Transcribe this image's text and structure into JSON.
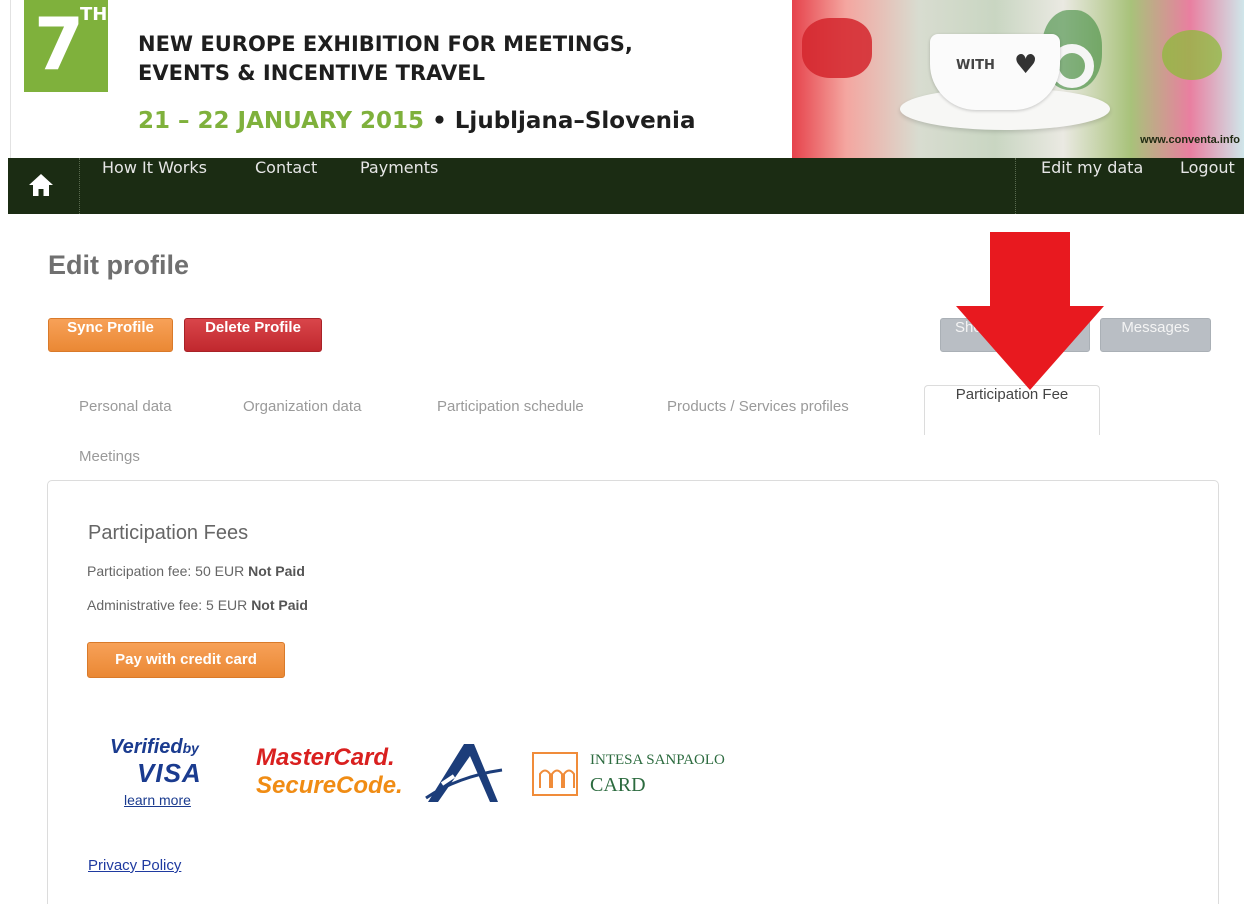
{
  "banner": {
    "edition_number": "7",
    "edition_suffix": "TH",
    "headline_line1": "NEW EUROPE EXHIBITION FOR MEETINGS,",
    "headline_line2": "EVENTS & INCENTIVE TRAVEL",
    "dates": "21 – 22 JANUARY 2015",
    "bullet": "•",
    "location": "Ljubljana–Slovenia",
    "cup_text": "WITH",
    "url": "www.conventa.info"
  },
  "nav": {
    "items": [
      {
        "label": "How It Works"
      },
      {
        "label": "Contact"
      },
      {
        "label": "Payments"
      }
    ],
    "right_items": [
      {
        "label": "Edit my data"
      },
      {
        "label": "Logout"
      }
    ]
  },
  "page": {
    "title": "Edit profile",
    "buttons": {
      "sync": "Sync Profile",
      "delete": "Delete Profile",
      "show": "Sho",
      "messages": "Messages"
    },
    "tabs": [
      {
        "label": "Personal data"
      },
      {
        "label": "Organization data"
      },
      {
        "label": "Participation schedule"
      },
      {
        "label": "Products / Services profiles"
      },
      {
        "label": "Participation Fee",
        "active": true
      },
      {
        "label": "Meetings"
      }
    ]
  },
  "fees": {
    "title": "Participation Fees",
    "participation_label": "Participation fee: 50 EUR",
    "participation_status": "Not Paid",
    "admin_label": "Administrative fee: 5 EUR",
    "admin_status": "Not Paid",
    "pay_button": "Pay with credit card"
  },
  "logos": {
    "visa_verified": "Verified",
    "visa_by": "by",
    "visa_word": "VISA",
    "visa_learn_more": "learn more",
    "mastercard_1": "MasterCard.",
    "mastercard_2": "SecureCode.",
    "intesa_1": "INTESA SANPAOLO",
    "intesa_2": "CARD"
  },
  "footer": {
    "privacy": "Privacy Policy"
  },
  "colors": {
    "brand_green": "#7fb13c",
    "nav_bg": "#1b2c13",
    "orange_button": "#ea8834",
    "red_button": "#c0282e",
    "annotation_arrow": "#e8191f"
  }
}
